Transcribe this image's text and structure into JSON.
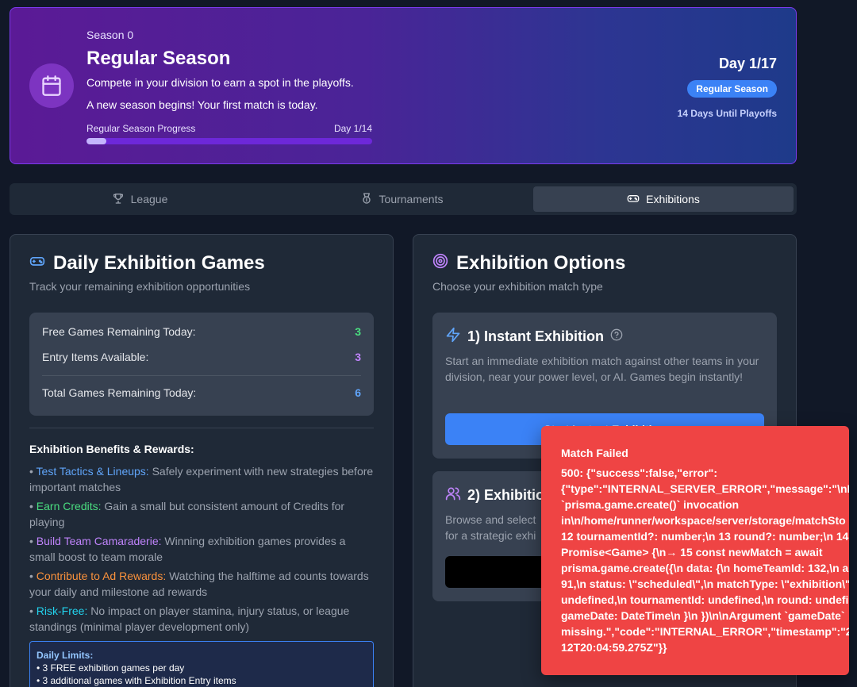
{
  "hero": {
    "season": "Season 0",
    "title": "Regular Season",
    "description": "Compete in your division to earn a spot in the playoffs.",
    "message": "A new season begins! Your first match is today.",
    "progress_label": "Regular Season Progress",
    "progress_day": "Day 1/14",
    "progress_fraction": 0.07,
    "day": "Day 1/17",
    "badge": "Regular Season",
    "until": "14 Days Until Playoffs",
    "icon": "calendar-icon"
  },
  "tabs": [
    {
      "label": "League",
      "icon": "trophy-icon"
    },
    {
      "label": "Tournaments",
      "icon": "medal-icon"
    },
    {
      "label": "Exhibitions",
      "icon": "gamepad-icon",
      "active": true
    }
  ],
  "daily": {
    "title": "Daily Exhibition Games",
    "subtitle": "Track your remaining exhibition opportunities",
    "free_label": "Free Games Remaining Today:",
    "free_value": "3",
    "entry_label": "Entry Items Available:",
    "entry_value": "3",
    "total_label": "Total Games Remaining Today:",
    "total_value": "6",
    "benefits_title": "Exhibition Benefits & Rewards:",
    "benefits": [
      {
        "name": "Test Tactics & Lineups:",
        "text": "Safely experiment with new strategies before important matches"
      },
      {
        "name": "Earn Credits:",
        "text": "Gain a small but consistent amount of Credits for playing"
      },
      {
        "name": "Build Team Camaraderie:",
        "text": "Winning exhibition games provides a small boost to team morale"
      },
      {
        "name": "Contribute to Ad Rewards:",
        "text": "Watching the halftime ad counts towards your daily and milestone ad rewards"
      },
      {
        "name": "Risk-Free:",
        "text": "No impact on player stamina, injury status, or league standings (minimal player development only)"
      }
    ],
    "limits_title": "Daily Limits:",
    "limits": [
      "• 3 FREE exhibition games per day",
      "• 3 additional games with Exhibition Entry items"
    ]
  },
  "options": {
    "title": "Exhibition Options",
    "subtitle": "Choose your exhibition match type",
    "instant_title": "1) Instant Exhibition",
    "instant_desc": "Start an immediate exhibition match against other teams in your division, near your power level, or AI. Games begin instantly!",
    "instant_button": "Start Instant Exhibition",
    "choose_title": "2) Exhibition",
    "choose_desc": "Browse and select\nfor a strategic exhi"
  },
  "toast": {
    "title": "Match Failed",
    "message": "500: {\"success\":false,\"error\":\n{\"type\":\"INTERNAL_SERVER_ERROR\",\"message\":\"\\nInv\n`prisma.game.create()` invocation\nin\\n/home/runner/workspace/server/storage/matchSto\n12 tournamentId?: number;\\n 13 round?: number;\\n 14 }\nPromise<Game> {\\n→ 15 const newMatch = await\nprisma.game.create({\\n data: {\\n homeTeamId: 132,\\n a\n91,\\n status: \\\"scheduled\\\",\\n matchType: \\\"exhibition\\\",\nundefined,\\n tournamentId: undefined,\\n round: undefi\ngameDate: DateTime\\n }\\n })\\n\\nArgument `gameDate`\nmissing.\",\"code\":\"INTERNAL_ERROR\",\"timestamp\":\"202\n12T20:04:59.275Z\"}}"
  },
  "colors": {
    "accent": "#3b82f6",
    "error": "#ef4444",
    "success": "#4ade80",
    "purple": "#c084fc"
  }
}
